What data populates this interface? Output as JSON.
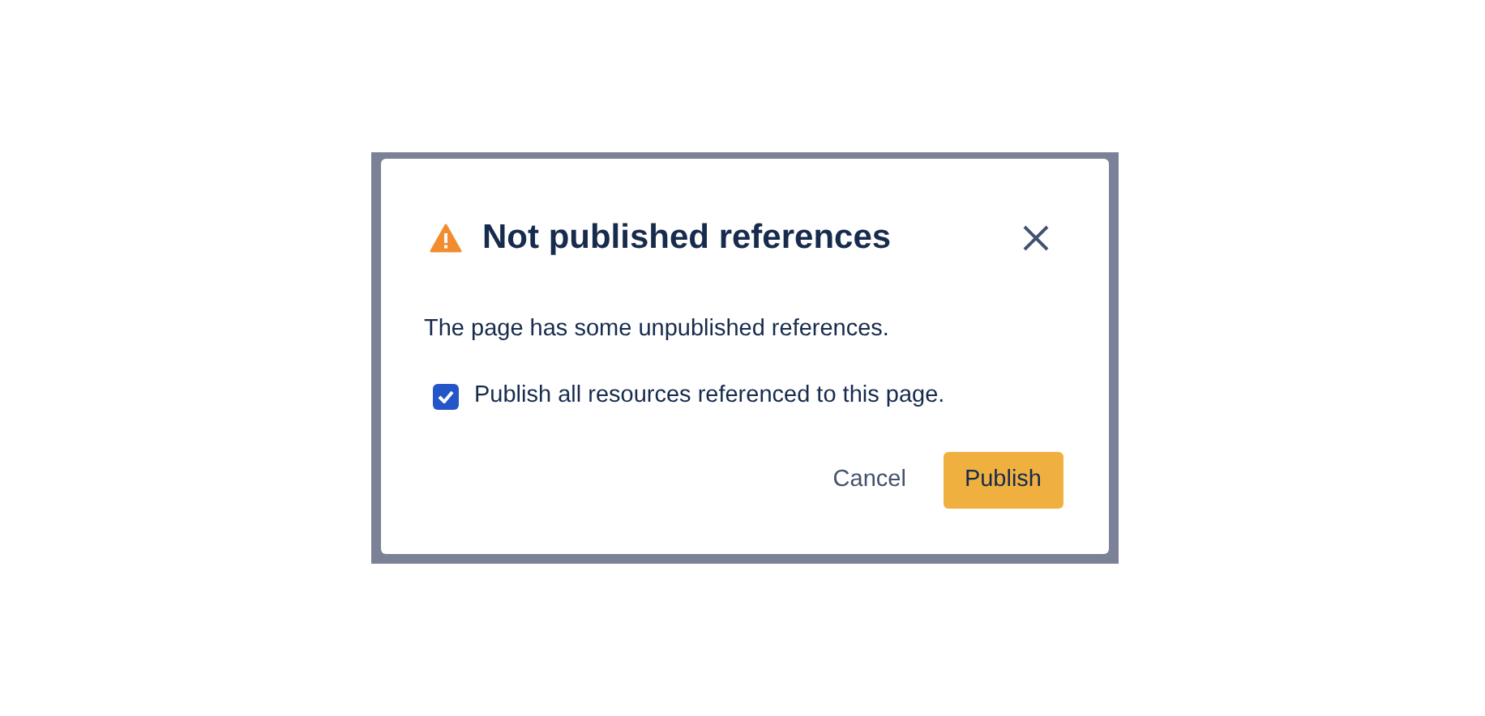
{
  "dialog": {
    "title": "Not published references",
    "message": "The page has some unpublished references.",
    "checkbox": {
      "label": "Publish all resources referenced to this page.",
      "checked": true
    },
    "buttons": [
      {
        "label": "Cancel",
        "kind": "subtle"
      },
      {
        "label": "Publish",
        "kind": "primary"
      }
    ]
  }
}
